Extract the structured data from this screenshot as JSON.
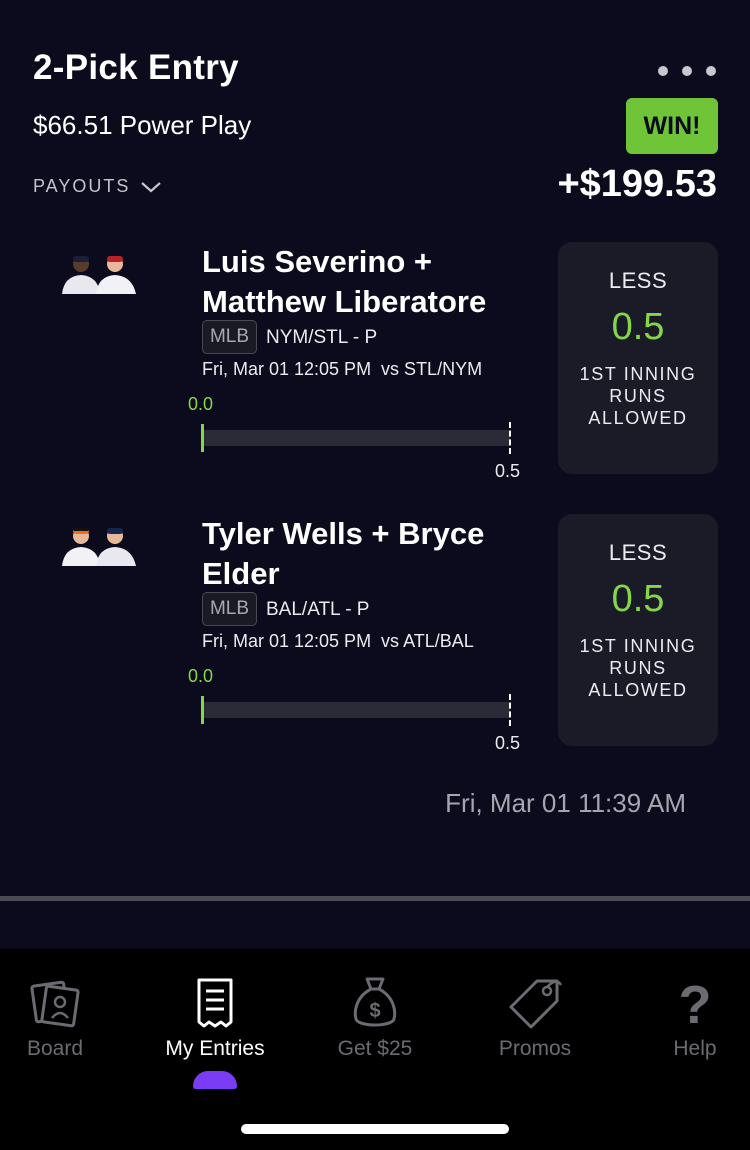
{
  "entry": {
    "title": "2-Pick Entry",
    "subtitle": "$66.51 Power Play",
    "payouts_label": "PAYOUTS",
    "status": "WIN!",
    "payout": "+$199.53",
    "date": "Fri, Mar 01 11:39 AM"
  },
  "picks": [
    {
      "players": "Luis Severino + Matthew Liberatore",
      "league": "MLB",
      "team_pos": "NYM/STL - P",
      "game": "Fri, Mar 01 12:05 PM  vs STL/NYM",
      "current": "0.0",
      "line_label": "0.5",
      "direction": "LESS",
      "line": "0.5",
      "stat": "1ST INNING RUNS ALLOWED",
      "progress": 0
    },
    {
      "players": "Tyler Wells + Bryce Elder",
      "league": "MLB",
      "team_pos": "BAL/ATL - P",
      "game": "Fri, Mar 01 12:05 PM  vs ATL/BAL",
      "current": "0.0",
      "line_label": "0.5",
      "direction": "LESS",
      "line": "0.5",
      "stat": "1ST INNING RUNS ALLOWED",
      "progress": 0
    }
  ],
  "nav": {
    "items": [
      {
        "label": "Board",
        "icon": "board-icon"
      },
      {
        "label": "My Entries",
        "icon": "receipt-icon"
      },
      {
        "label": "Get $25",
        "icon": "money-bag-icon"
      },
      {
        "label": "Promos",
        "icon": "tag-icon"
      },
      {
        "label": "Help",
        "icon": "question-icon"
      }
    ],
    "active": "My Entries"
  },
  "colors": {
    "background": "#0b0b1d",
    "win": "#6fc537",
    "accent_green": "#86d64a",
    "card": "#1a1b27",
    "active_indicator": "#7b3cf5"
  }
}
